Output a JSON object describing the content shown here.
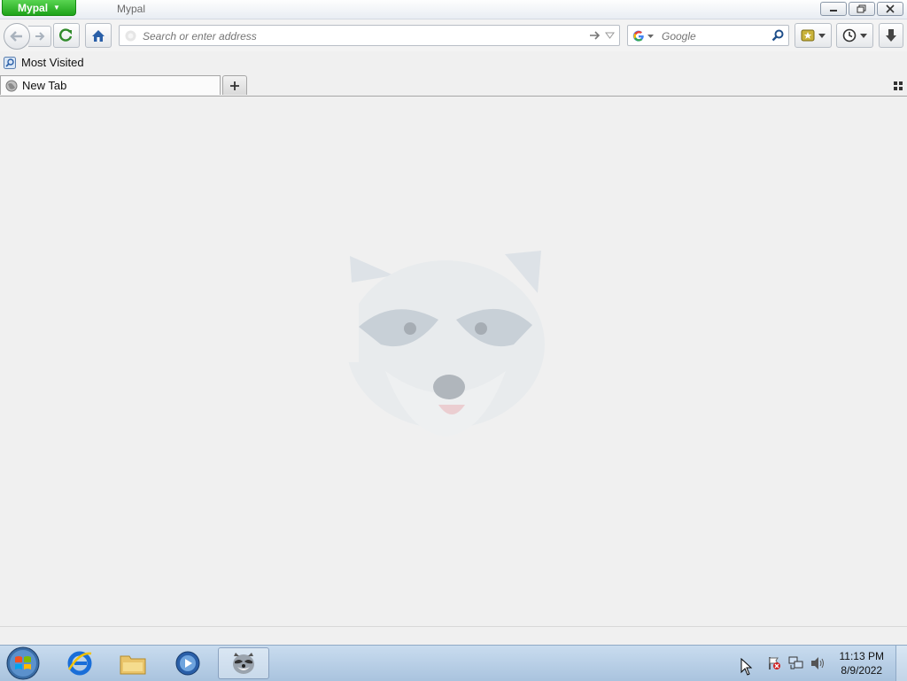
{
  "app": {
    "menu_button_label": "Mypal",
    "window_title": "Mypal"
  },
  "navigation": {
    "address_placeholder": "Search or enter address",
    "search_placeholder": "Google"
  },
  "bookmarks": {
    "items": [
      {
        "label": "Most Visited"
      }
    ]
  },
  "tabs": [
    {
      "label": "New Tab"
    }
  ],
  "taskbar": {
    "apps": [
      "start-orb",
      "internet-explorer",
      "file-explorer",
      "media-player",
      "mypal"
    ],
    "clock": {
      "time": "11:13 PM",
      "date": "8/9/2022"
    }
  },
  "colors": {
    "accent_green": "#1ea31a",
    "taskbar": "#b8cfe6",
    "page_bg": "#f0f0f0"
  }
}
